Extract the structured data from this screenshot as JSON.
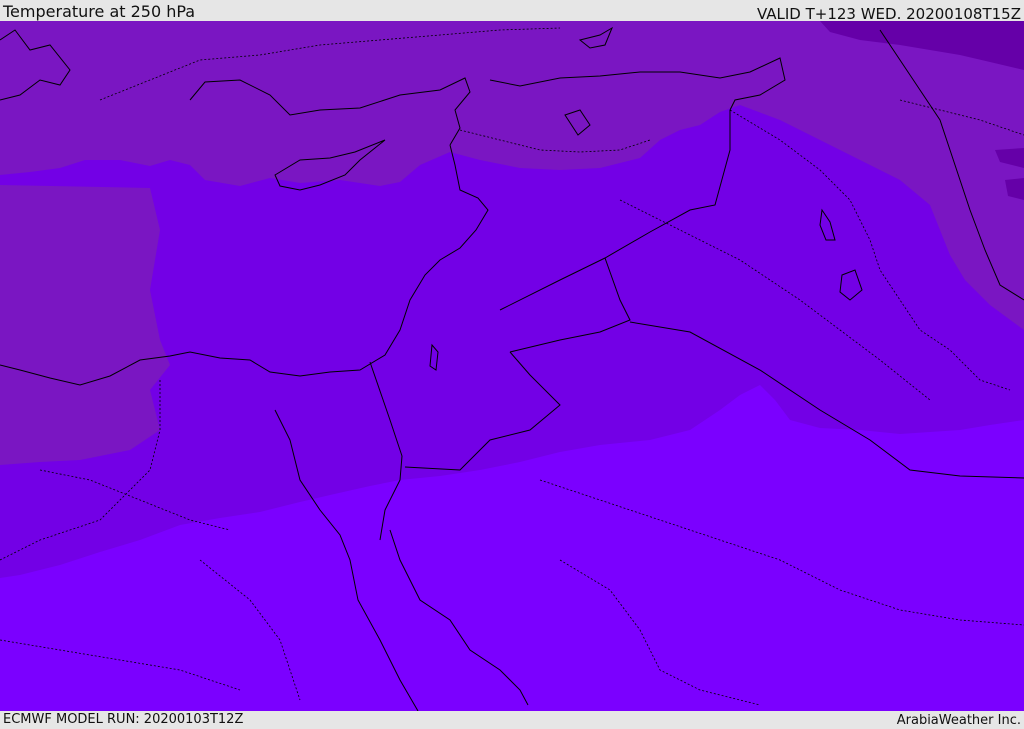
{
  "header": {
    "title": "Temperature at 250 hPa",
    "valid": "VALID T+123 WED. 20200108T15Z"
  },
  "footer": {
    "model_run": "ECMWF MODEL RUN: 20200103T12Z",
    "brand": "ArabiaWeather Inc."
  },
  "colors": {
    "warm": "#7b00ff",
    "mid": "#7300e6",
    "cool": "#7a16c2",
    "coolest": "#6500a8",
    "border": "#000000",
    "frame": "#e6e6e6"
  }
}
